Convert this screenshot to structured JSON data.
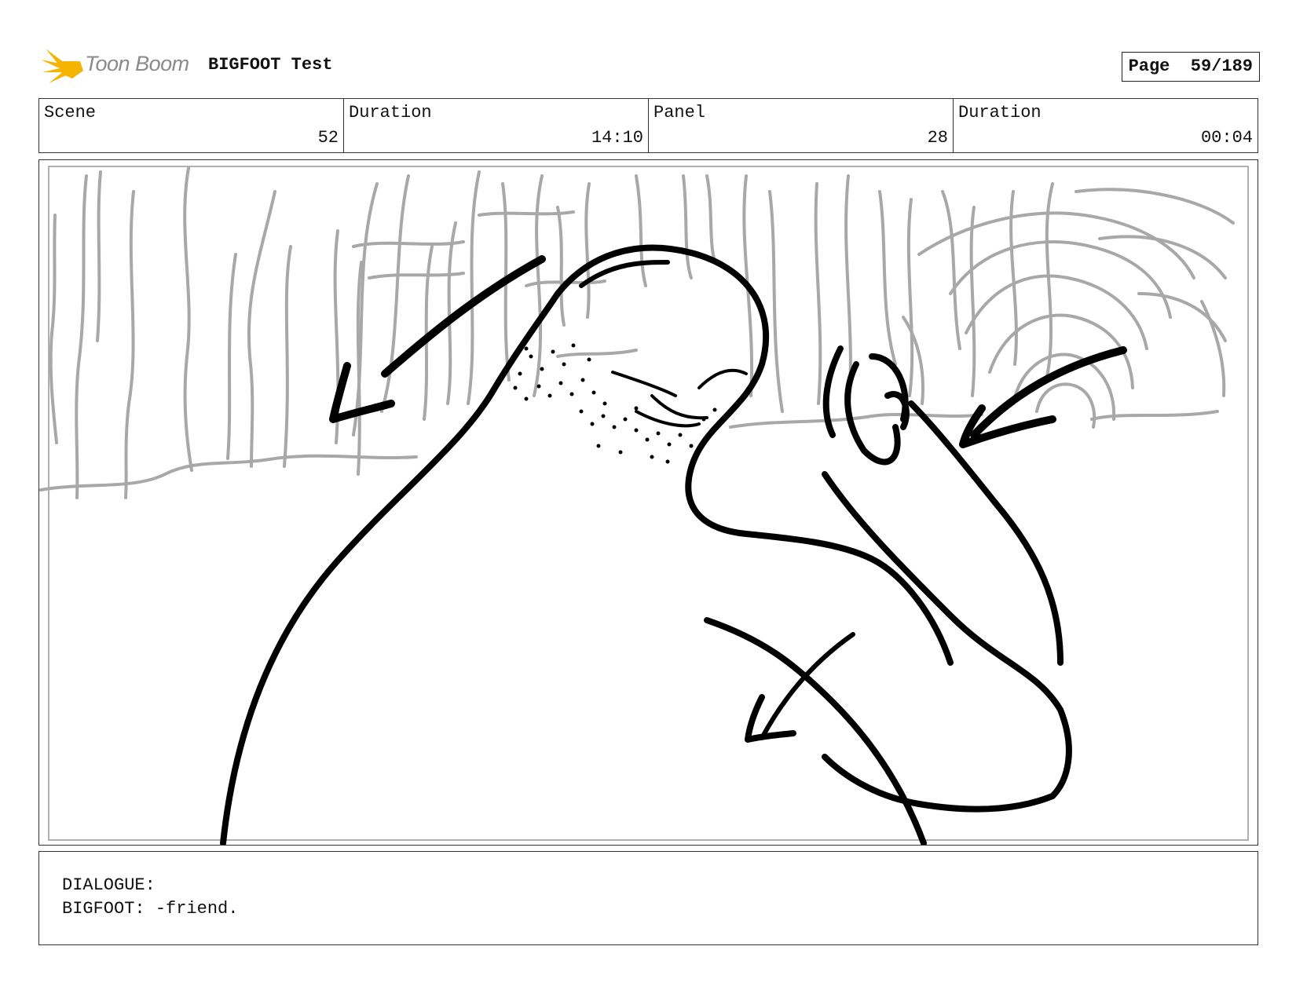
{
  "header": {
    "logo_text": "Toon Boom",
    "project_title": "BIGFOOT Test",
    "page_label": "Page",
    "page_number": "59/189"
  },
  "info": {
    "scene_label": "Scene",
    "scene_value": "52",
    "scene_duration_label": "Duration",
    "scene_duration_value": "14:10",
    "panel_label": "Panel",
    "panel_value": "28",
    "panel_duration_label": "Duration",
    "panel_duration_value": "00:04"
  },
  "dialogue": {
    "heading": "DIALOGUE:",
    "line": "BIGFOOT: -friend."
  },
  "colors": {
    "logo_yellow": "#f5b400",
    "sketch_grey": "#a8a8a8",
    "ink": "#000000"
  }
}
